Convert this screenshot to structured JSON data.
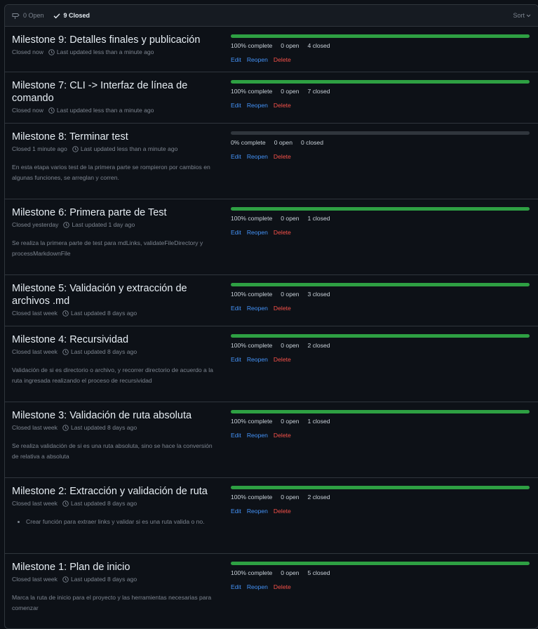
{
  "header": {
    "open_label": "0 Open",
    "closed_label": "9 Closed",
    "sort_label": "Sort"
  },
  "actions": {
    "edit": "Edit",
    "reopen": "Reopen",
    "delete": "Delete"
  },
  "milestones": [
    {
      "title": "Milestone 9: Detalles finales y publicación",
      "closed": "Closed now",
      "updated": "Last updated less than a minute ago",
      "progress": 1.0,
      "percent": "100% complete",
      "open": "0 open",
      "closed_count": "4 closed",
      "description": ""
    },
    {
      "title": "Milestone 7: CLI -> Interfaz de línea de comando",
      "closed": "Closed now",
      "updated": "Last updated less than a minute ago",
      "progress": 1.0,
      "percent": "100% complete",
      "open": "0 open",
      "closed_count": "7 closed",
      "description": ""
    },
    {
      "title": "Milestone 8: Terminar test",
      "closed": "Closed 1 minute ago",
      "updated": "Last updated less than a minute ago",
      "progress": 0.0,
      "percent": "0% complete",
      "open": "0 open",
      "closed_count": "0 closed",
      "description": "En esta etapa varios test de la primera parte se rompieron por cambios en algunas funciones, se arreglan y corren."
    },
    {
      "title": "Milestone 6: Primera parte de Test",
      "closed": "Closed yesterday",
      "updated": "Last updated 1 day ago",
      "progress": 1.0,
      "percent": "100% complete",
      "open": "0 open",
      "closed_count": "1 closed",
      "description": "Se realiza la primera parte de test para mdLinks, validateFileDirectory y processMarkdownFile"
    },
    {
      "title": "Milestone 5: Validación y extracción de archivos .md",
      "closed": "Closed last week",
      "updated": "Last updated 8 days ago",
      "progress": 1.0,
      "percent": "100% complete",
      "open": "0 open",
      "closed_count": "3 closed",
      "description": ""
    },
    {
      "title": "Milestone 4: Recursividad",
      "closed": "Closed last week",
      "updated": "Last updated 8 days ago",
      "progress": 1.0,
      "percent": "100% complete",
      "open": "0 open",
      "closed_count": "2 closed",
      "description": "Validación de si es directorio o archivo, y recorrer directorio de acuerdo a la ruta ingresada realizando el proceso de recursividad"
    },
    {
      "title": "Milestone 3: Validación de ruta absoluta",
      "closed": "Closed last week",
      "updated": "Last updated 8 days ago",
      "progress": 1.0,
      "percent": "100% complete",
      "open": "0 open",
      "closed_count": "1 closed",
      "description": "Se realiza validación de si es una ruta absoluta, sino se hace la conversión de relativa a absoluta"
    },
    {
      "title": "Milestone 2: Extracción y validación de ruta",
      "closed": "Closed last week",
      "updated": "Last updated 8 days ago",
      "progress": 1.0,
      "percent": "100% complete",
      "open": "0 open",
      "closed_count": "2 closed",
      "description": "",
      "bullet": "Crear función para extraer links y validar si es una ruta valida o no."
    },
    {
      "title": "Milestone 1: Plan de inicio",
      "closed": "Closed last week",
      "updated": "Last updated 8 days ago",
      "progress": 1.0,
      "percent": "100% complete",
      "open": "0 open",
      "closed_count": "5 closed",
      "description": "Marca la ruta de inicio para el proyecto y las herramientas necesarias para comenzar"
    }
  ]
}
